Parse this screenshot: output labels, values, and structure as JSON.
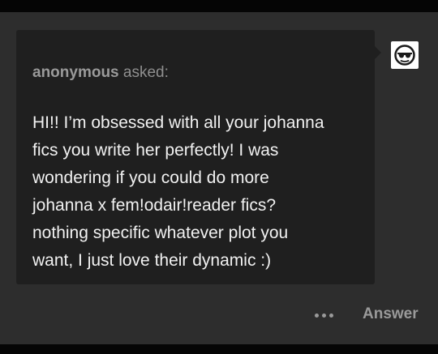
{
  "ask": {
    "asker_name": "anonymous",
    "asked_suffix": " asked:",
    "question": "HI!! I’m obsessed with all your johanna\nfics you write her perfectly! I was\nwondering if you could do more\njohanna x fem!odair!reader fics?\nnothing specific whatever plot you\nwant, I just love their dynamic :)",
    "avatar_icon": "anonymous-sunglasses-icon"
  },
  "actions": {
    "more_icon": "ellipsis-icon",
    "answer_label": "Answer"
  },
  "colors": {
    "background": "#2d2d2d",
    "bubble": "#1f1f1f",
    "text": "#f1f1f1",
    "muted": "#9a9a9a"
  }
}
